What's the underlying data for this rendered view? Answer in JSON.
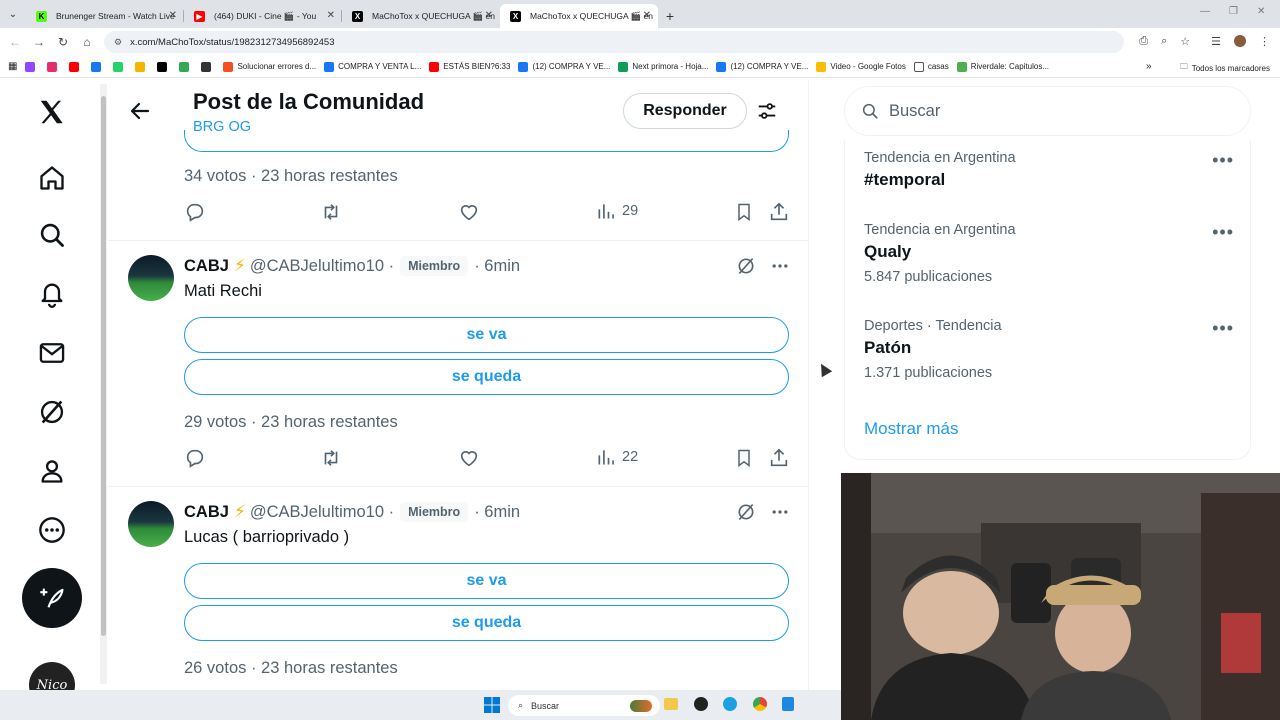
{
  "browser": {
    "tabs": [
      {
        "title": "Brunenger Stream - Watch Live",
        "favicon_color": "#53fc18",
        "favicon_glyph": "K",
        "active": false
      },
      {
        "title": "(464) DUKI - Cine 🎬 - You",
        "favicon_color": "#ff0000",
        "favicon_glyph": "▶",
        "active": false,
        "audio": true
      },
      {
        "title": "MaChoTox x QUECHUGA 🎬 en",
        "favicon_color": "#000000",
        "favicon_glyph": "X",
        "active": false
      },
      {
        "title": "MaChoTox x QUECHUGA 🎬 en",
        "favicon_color": "#000000",
        "favicon_glyph": "X",
        "active": true
      }
    ],
    "url": "x.com/MaChoTox/status/1982312734956892453",
    "bookmarks": [
      {
        "label": "",
        "color": "#9146ff"
      },
      {
        "label": "",
        "color": "#e1306c"
      },
      {
        "label": "",
        "color": "#ff0000"
      },
      {
        "label": "",
        "color": "#1877f2"
      },
      {
        "label": "",
        "color": "#25d366"
      },
      {
        "label": "",
        "color": "#f4b400"
      },
      {
        "label": "",
        "color": "#000000"
      },
      {
        "label": "",
        "color": "#34a853"
      },
      {
        "label": "",
        "color": "#333333"
      },
      {
        "label": "Solucionar errores d...",
        "color": "#f25022"
      },
      {
        "label": "COMPRA Y VENTA L...",
        "color": "#1877f2"
      },
      {
        "label": "ESTÁS BIEN?6:33",
        "color": "#ff0000"
      },
      {
        "label": "(12) COMPRA Y VE...",
        "color": "#1877f2"
      },
      {
        "label": "Next primora - Hoja...",
        "color": "#0f9d58"
      },
      {
        "label": "(12) COMPRA Y VE...",
        "color": "#1877f2"
      },
      {
        "label": "Video - Google Fotos",
        "color": "#fbbc05"
      },
      {
        "label": "casas",
        "color": "#ffffff"
      },
      {
        "label": "Riverdale: Capitulos...",
        "color": "#4caf50"
      }
    ],
    "bookmarks_overflow": "»",
    "all_bookmarks": "Todos los marcadores"
  },
  "header": {
    "title": "Post de la Comunidad",
    "subtitle": "BRG OG",
    "reply_label": "Responder"
  },
  "top_post": {
    "meta": "34 votos · 23 horas restantes",
    "views": "29"
  },
  "posts": [
    {
      "name": "CABJ",
      "handle": "@CABJelultimo10 ·",
      "badge": "Miembro",
      "time": "· 6min",
      "text": "Mati Rechi",
      "options": [
        "se va",
        "se queda"
      ],
      "meta": "29 votos · 23 horas restantes",
      "views": "22"
    },
    {
      "name": "CABJ",
      "handle": "@CABJelultimo10 ·",
      "badge": "Miembro",
      "time": "· 6min",
      "text": "Lucas ( barrioprivado )",
      "options": [
        "se va",
        "se queda"
      ],
      "meta": "26 votos · 23 horas restantes"
    }
  ],
  "sidebar": {
    "search_placeholder": "Buscar",
    "trends": [
      {
        "context": "Tendencia en Argentina",
        "title": "#temporal",
        "count": ""
      },
      {
        "context": "Tendencia en Argentina",
        "title": "Qualy",
        "count": "5.847 publicaciones"
      },
      {
        "context": "Deportes · Tendencia",
        "title": "Patón",
        "count": "1.371 publicaciones"
      }
    ],
    "show_more": "Mostrar más"
  },
  "taskbar": {
    "search_placeholder": "Buscar"
  },
  "colors": {
    "accent": "#1d9bf0",
    "text": "#0f1419",
    "muted": "#536471"
  }
}
